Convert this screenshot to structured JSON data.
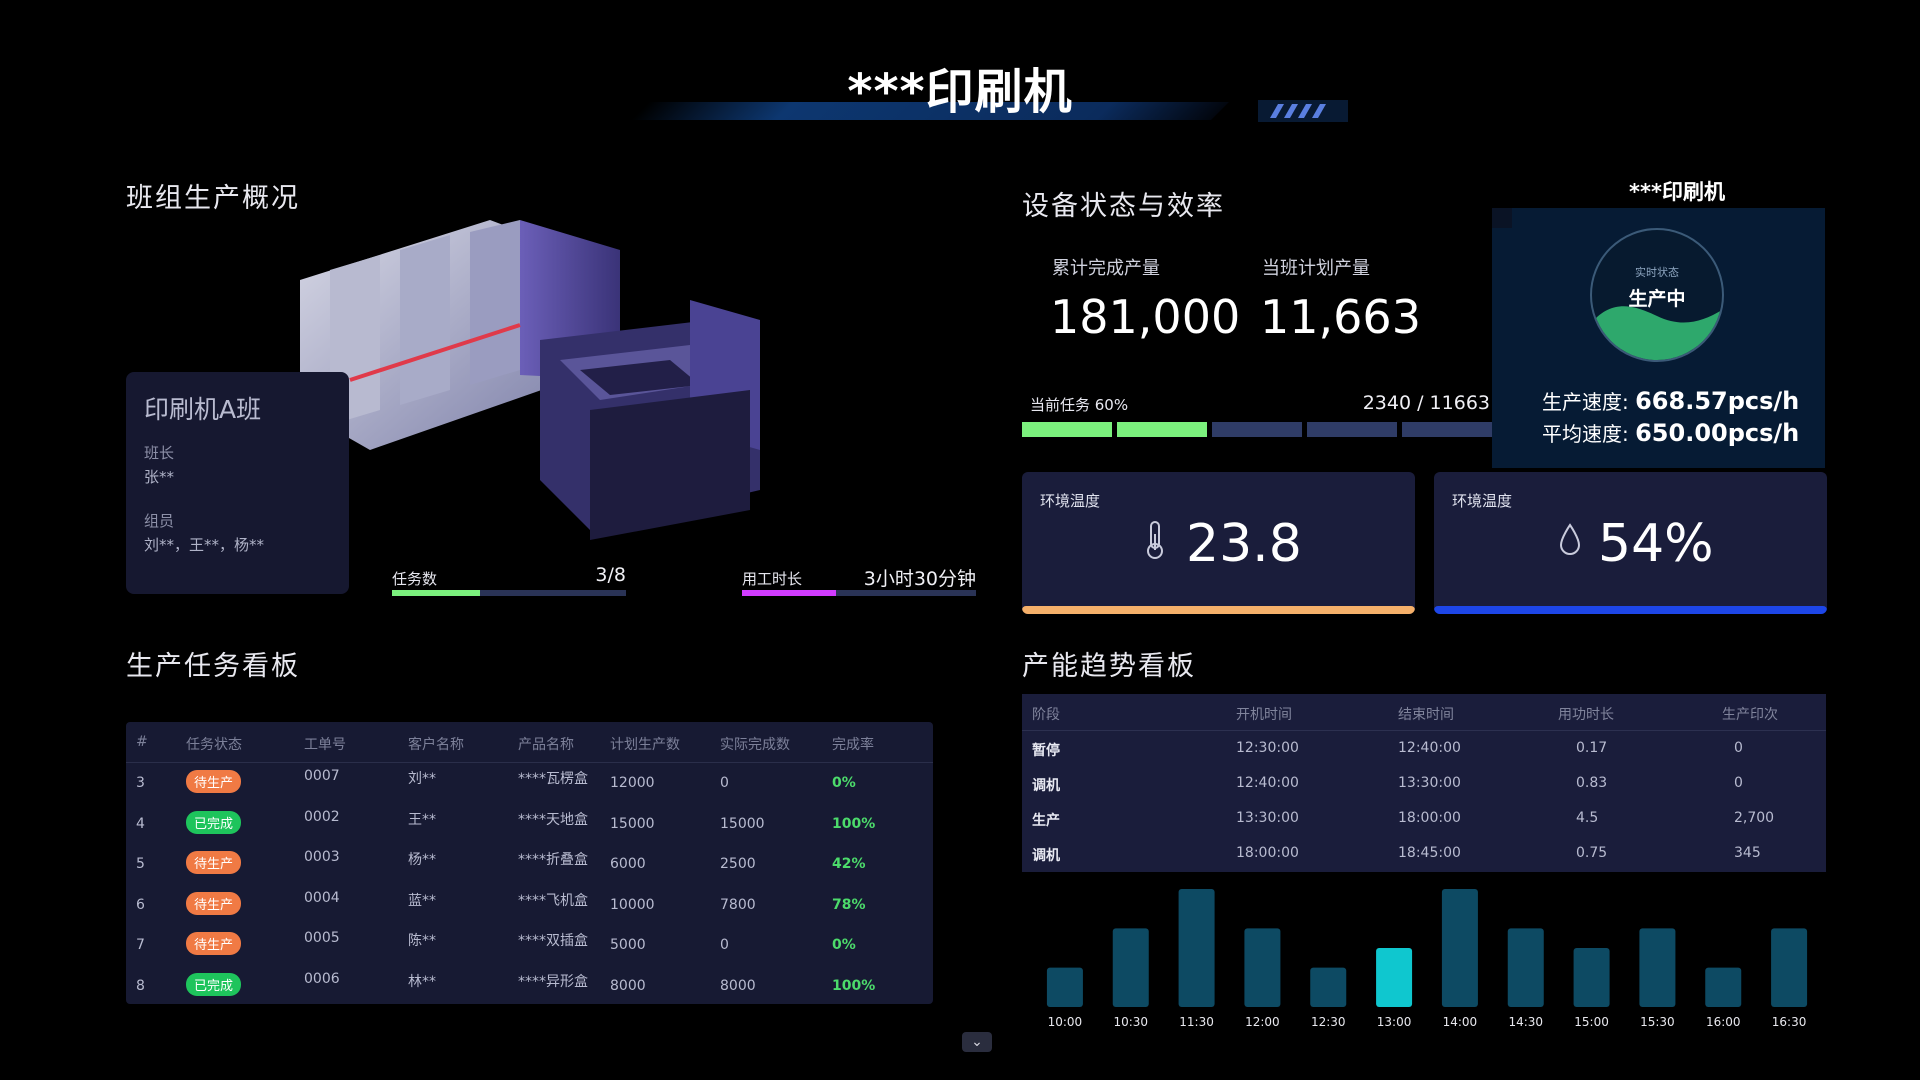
{
  "header": {
    "title": "***印刷机"
  },
  "team_overview": {
    "section_title": "班组生产概况",
    "team_name": "印刷机A班",
    "leader_label": "班长",
    "leader_value": "张**",
    "members_label": "组员",
    "members_value": "刘**，王**，杨**",
    "task_count": {
      "label": "任务数",
      "value": "3/8",
      "progress": 0.375,
      "color": "#7bf07d"
    },
    "work_time": {
      "label": "用工时长",
      "value": "3小时30分钟",
      "progress": 0.4,
      "color": "#d23cff"
    }
  },
  "task_board": {
    "section_title": "生产任务看板",
    "columns": [
      "#",
      "任务状态",
      "工单号",
      "客户名称",
      "产品名称",
      "计划生产数",
      "实际完成数",
      "完成率"
    ],
    "rows": [
      {
        "no": "3",
        "status": "待生产",
        "status_type": "pending",
        "order": "0007",
        "customer": "刘**",
        "product": "****瓦楞盒",
        "plan": "12000",
        "actual": "0",
        "rate": "0%"
      },
      {
        "no": "4",
        "status": "已完成",
        "status_type": "done",
        "order": "0002",
        "customer": "王**",
        "product": "****天地盒",
        "plan": "15000",
        "actual": "15000",
        "rate": "100%"
      },
      {
        "no": "5",
        "status": "待生产",
        "status_type": "pending",
        "order": "0003",
        "customer": "杨**",
        "product": "****折叠盒",
        "plan": "6000",
        "actual": "2500",
        "rate": "42%"
      },
      {
        "no": "6",
        "status": "待生产",
        "status_type": "pending",
        "order": "0004",
        "customer": "蓝**",
        "product": "****飞机盒",
        "plan": "10000",
        "actual": "7800",
        "rate": "78%"
      },
      {
        "no": "7",
        "status": "待生产",
        "status_type": "pending",
        "order": "0005",
        "customer": "陈**",
        "product": "****双插盒",
        "plan": "5000",
        "actual": "0",
        "rate": "0%"
      },
      {
        "no": "8",
        "status": "已完成",
        "status_type": "done",
        "order": "0006",
        "customer": "林**",
        "product": "****异形盒",
        "plan": "8000",
        "actual": "8000",
        "rate": "100%"
      }
    ]
  },
  "equipment": {
    "section_title": "设备状态与效率",
    "cumulative_label": "累计完成产量",
    "cumulative_value": "181,000",
    "plan_label": "当班计划产量",
    "plan_value": "11,663",
    "current_task_label": "当前任务 60%",
    "current_task_value": "2340 / 11663",
    "segments_on": 2,
    "segments_total": 5
  },
  "status_panel": {
    "machine_name": "***印刷机",
    "circle_label": "实时状态",
    "status": "生产中",
    "speed_label": "生产速度:",
    "speed_value": "668.57pcs/h",
    "avg_label": "平均速度:",
    "avg_value": "650.00pcs/h",
    "colors": {
      "wave": "#2ea86c",
      "ring": "#3b5a78"
    }
  },
  "env": {
    "temperature": {
      "label": "环境温度",
      "value": "23.8",
      "icon": "thermometer-icon",
      "color": "#f5b06a"
    },
    "humidity": {
      "label": "环境温度",
      "value": "54%",
      "icon": "droplet-icon",
      "color": "#1d46e8"
    }
  },
  "capacity": {
    "section_title": "产能趋势看板",
    "columns": [
      "阶段",
      "开机时间",
      "结束时间",
      "用功时长",
      "生产印次"
    ],
    "rows": [
      {
        "phase": "暂停",
        "start": "12:30:00",
        "end": "12:40:00",
        "duration": "0.17",
        "count": "0"
      },
      {
        "phase": "调机",
        "start": "12:40:00",
        "end": "13:30:00",
        "duration": "0.83",
        "count": "0"
      },
      {
        "phase": "生产",
        "start": "13:30:00",
        "end": "18:00:00",
        "duration": "4.5",
        "count": "2,700"
      },
      {
        "phase": "调机",
        "start": "18:00:00",
        "end": "18:45:00",
        "duration": "0.75",
        "count": "345"
      }
    ]
  },
  "chart_data": {
    "type": "bar",
    "categories": [
      "10:00",
      "10:30",
      "11:30",
      "12:00",
      "12:30",
      "13:00",
      "14:00",
      "14:30",
      "15:00",
      "15:30",
      "16:00",
      "16:30"
    ],
    "values": [
      1,
      2,
      3,
      2,
      1,
      1.5,
      3,
      2,
      1.5,
      2,
      1,
      2
    ],
    "highlight_index": 5,
    "ylim": [
      0,
      3
    ],
    "colors": {
      "bar": "#0d4a63",
      "highlight": "#0fc7cf"
    }
  },
  "footer": {
    "scroll_icon": "chevron-down-icon",
    "scroll_glyph": "⌄"
  }
}
